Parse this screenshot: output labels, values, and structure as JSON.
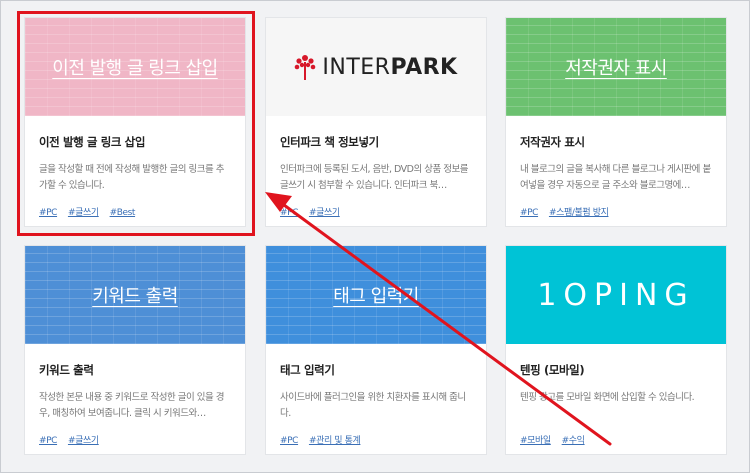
{
  "cards": [
    {
      "thumb_title": "이전 발행 글 링크 삽입",
      "title": "이전 발행 글 링크 삽입",
      "desc": "글을 작성할 때 전에 작성해 발행한 글의 링크를 추가할 수 있습니다.",
      "tags": [
        "#PC",
        "#글쓰기",
        "#Best"
      ],
      "thumb_color": "#f0b6c6"
    },
    {
      "logo_text_light": "INTER",
      "logo_text_bold": "PARK",
      "title": "인터파크 책 정보넣기",
      "desc": "인터파크에 등록된 도서, 음반, DVD의 상품 정보를 글쓰기 시 첨부할 수 있습니다. 인터파크 북…",
      "tags": [
        "#PC",
        "#글쓰기"
      ],
      "logo_color": "#d7182a"
    },
    {
      "thumb_title": "저작권자 표시",
      "title": "저작권자 표시",
      "desc": "내 블로그의 글을 복사해 다른 블로그나 게시판에 붙여넣을 경우 자동으로 글 주소와 블로그명에…",
      "tags": [
        "#PC",
        "#스팸/불펌 방지"
      ],
      "thumb_color": "#6cc170"
    },
    {
      "thumb_title": "키워드 출력",
      "title": "키워드 출력",
      "desc": "작성한 본문 내용 중 키워드로 작성한 글이 있을 경우, 매칭하여 보여줍니다. 클릭 시 키워드와…",
      "tags": [
        "#PC",
        "#글쓰기"
      ],
      "thumb_color": "#4e8fd6"
    },
    {
      "thumb_title": "태그 입력기",
      "title": "태그 입력기",
      "desc": "사이드바에 플러그인을 위한 치환자를 표시해 줍니다.",
      "tags": [
        "#PC",
        "#관리 및 통계"
      ],
      "thumb_color": "#3f8fdc"
    },
    {
      "logo_text": "1OPING",
      "title": "텐핑 (모바일)",
      "desc": "텐핑 광고를 모바일 화면에 삽입할 수 있습니다.",
      "tags": [
        "#모바일",
        "#수익"
      ],
      "thumb_color": "#00c3d6"
    }
  ],
  "colors": {
    "highlight": "#e0141e",
    "tag_link": "#3a6fb6"
  }
}
